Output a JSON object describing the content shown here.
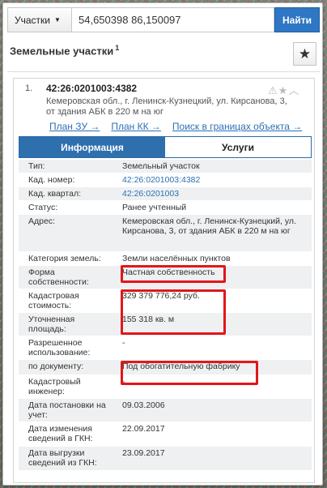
{
  "search": {
    "type_label": "Участки",
    "query": "54,650398 86,150097",
    "find_label": "Найти"
  },
  "header": {
    "title": "Земельные участки",
    "count": "1"
  },
  "result": {
    "number": "1.",
    "code": "42:26:0201003:4382",
    "address": "Кемеровская обл., г. Ленинск-Кузнецкий, ул. Кирсанова, 3, от здания АБК в 220 м на юг",
    "links": [
      "План ЗУ →",
      "План КК →",
      "Поиск в границах объекта →"
    ]
  },
  "tabs": [
    "Информация",
    "Услуги"
  ],
  "properties": [
    {
      "label": "Тип:",
      "value": "Земельный участок",
      "link": false
    },
    {
      "label": "Кад. номер:",
      "value": "42:26:0201003:4382",
      "link": true
    },
    {
      "label": "Кад. квартал:",
      "value": "42:26:0201003",
      "link": true
    },
    {
      "label": "Статус:",
      "value": "Ранее учтенный",
      "link": false
    },
    {
      "label": "Адрес:",
      "value": "Кемеровская обл., г. Ленинск-Кузнецкий, ул. Кирсанова, 3, от здания АБК в 220 м на юг",
      "link": false
    },
    {
      "label": "Категория земель:",
      "value": "Земли населённых пунктов",
      "link": false
    },
    {
      "label": "Форма собственности:",
      "value": "Частная собственность",
      "link": false
    },
    {
      "label": "Кадастровая стоимость:",
      "value": "329 379 776,24 руб.",
      "link": false
    },
    {
      "label": "Уточненная площадь:",
      "value": "155 318 кв. м",
      "link": false
    },
    {
      "label": "Разрешенное использование:",
      "value": "-",
      "link": false
    },
    {
      "label": "по документу:",
      "value": "Под обогатительную фабрику",
      "link": false
    },
    {
      "label": "Кадастровый инженер:",
      "value": "-",
      "link": false
    },
    {
      "label": "Дата постановки на учет:",
      "value": "09.03.2006",
      "link": false
    },
    {
      "label": "Дата изменения сведений в ГКН:",
      "value": "22.09.2017",
      "link": false
    },
    {
      "label": "Дата выгрузки сведений из ГКН:",
      "value": "23.09.2017",
      "link": false
    }
  ],
  "colors": {
    "accent": "#2e6fae",
    "highlight": "#e3161a",
    "link": "#2c6fb5"
  }
}
